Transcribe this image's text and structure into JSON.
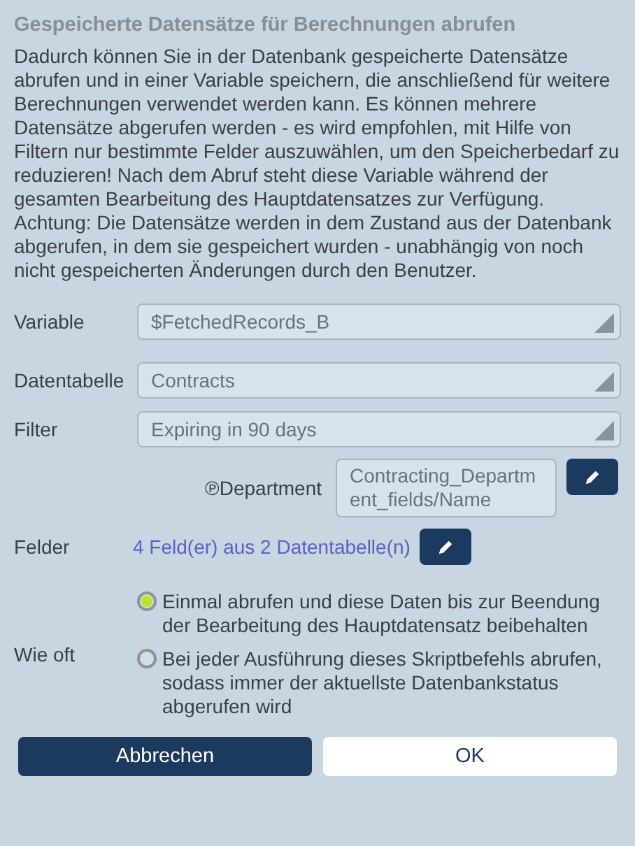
{
  "title": "Gespeicherte Datensätze für Berechnungen abrufen",
  "description": [
    "Dadurch können Sie in der Datenbank gespeicherte Datensätze abrufen und in einer Variable speichern, die anschließend für weitere Berechnungen verwendet werden kann. Es können mehrere Datensätze abgerufen werden - es wird empfohlen, mit Hilfe von Filtern nur bestimmte Felder auszuwählen, um den Speicherbedarf zu reduzieren! Nach dem Abruf steht diese Variable während der gesamten Bearbeitung des Hauptdatensatzes zur Verfügung.",
    "Achtung: Die Datensätze werden in dem Zustand aus der Datenbank abgerufen, in dem sie gespeichert wurden - unabhängig von noch nicht gespeicherten Änderungen durch den Benutzer."
  ],
  "selects": [
    {
      "label": "Variable",
      "value": "$FetchedRecords_B"
    },
    {
      "label": "Datentabelle",
      "value": "Contracts"
    },
    {
      "label": "Filter",
      "value": "Expiring in 90 days"
    }
  ],
  "department": {
    "label": "℗Department",
    "value": "Contracting_Department_fields/Name"
  },
  "fields": {
    "label": "Felder",
    "value": "4 Feld(er) aus 2 Datentabelle(n)"
  },
  "frequency": {
    "label": "Wie oft",
    "options": [
      {
        "label": "Einmal abrufen und diese Daten bis zur Beendung der Bearbeitung des Hauptdatensatz beibehalten",
        "selected": true
      },
      {
        "label": "Bei jeder Ausführung dieses Skriptbefehls abrufen, sodass immer der aktuellste Datenbankstatus abgerufen wird",
        "selected": false
      }
    ]
  },
  "buttons": [
    {
      "label": "Abbrechen",
      "kind": "primary"
    },
    {
      "label": "OK",
      "kind": "secondary"
    }
  ]
}
